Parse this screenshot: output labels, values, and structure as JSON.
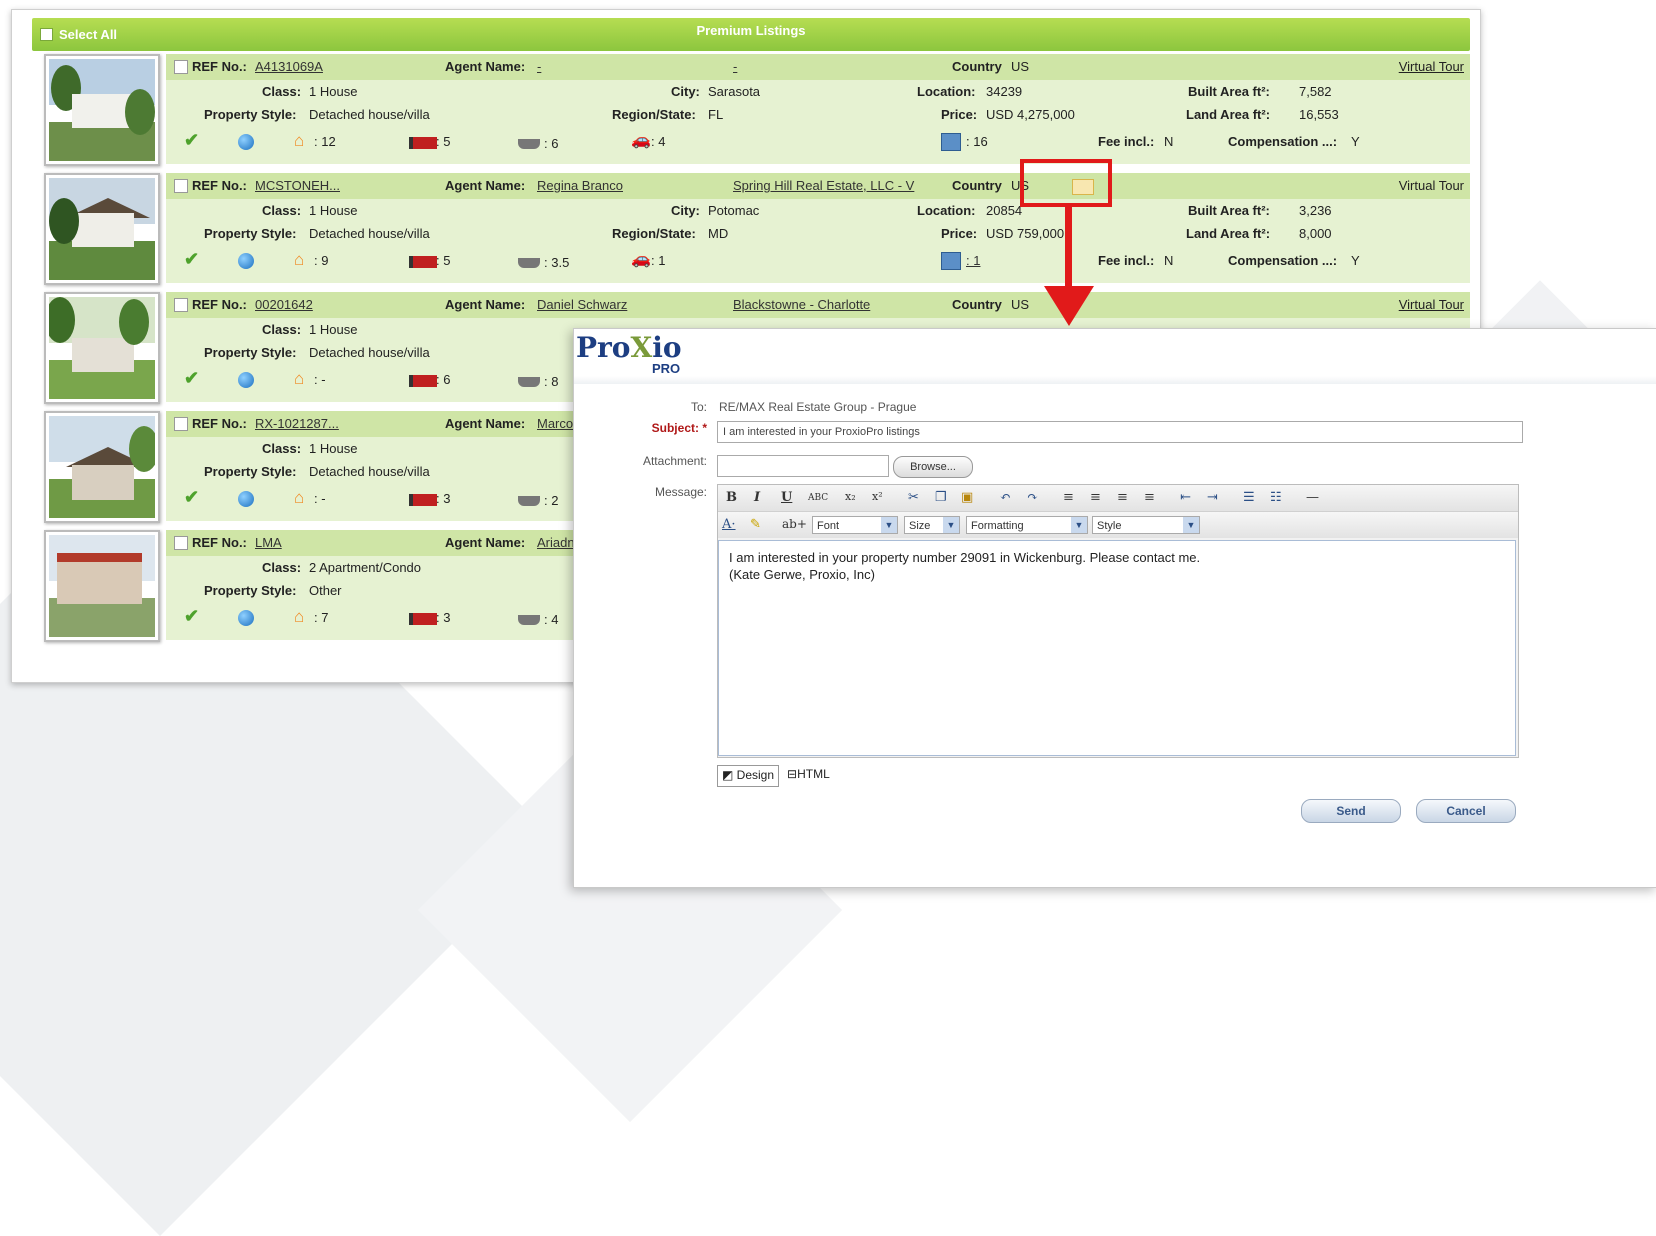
{
  "listings": {
    "select_all": "Select All",
    "title": "Premium Listings",
    "labels": {
      "ref": "REF No.:",
      "agent": "Agent Name:",
      "country": "Country",
      "class": "Class:",
      "city": "City:",
      "location": "Location:",
      "built": "Built Area ft²:",
      "style": "Property Style:",
      "region": "Region/State:",
      "price": "Price:",
      "land": "Land Area ft²:",
      "fee": "Fee incl.:",
      "comp": "Compensation ...:",
      "virtual_tour": "Virtual Tour"
    },
    "rows": [
      {
        "ref": "A4131069A",
        "agent": "-",
        "company": "-",
        "country": "US",
        "class": "1 House",
        "city": "Sarasota",
        "location": "34239",
        "built": "7,582",
        "style": "Detached house/villa",
        "region": "FL",
        "price": "USD 4,275,000",
        "land": "16,553",
        "rooms_home": ": 12",
        "beds": ": 5",
        "baths": ": 6",
        "cars": ": 4",
        "rooms": ": 16",
        "fee": "N",
        "comp": "Y"
      },
      {
        "ref": "MCSTONEH...",
        "agent": "Regina Branco",
        "company": "Spring Hill Real Estate, LLC - V",
        "country": "US",
        "class": "1 House",
        "city": "Potomac",
        "location": "20854",
        "built": "3,236",
        "style": "Detached house/villa",
        "region": "MD",
        "price": "USD 759,000",
        "land": "8,000",
        "rooms_home": ": 9",
        "beds": ": 5",
        "baths": ": 3.5",
        "cars": ": 1",
        "rooms": ": 1",
        "fee": "N",
        "comp": "Y"
      },
      {
        "ref": "00201642",
        "agent": "Daniel Schwarz",
        "company": "Blackstowne - Charlotte",
        "country": "US",
        "class": "1 House",
        "style": "Detached house/villa",
        "rooms_home": ": -",
        "beds": ": 6",
        "baths": ": 8"
      },
      {
        "ref": "RX-1021287...",
        "agent": "Marco R",
        "class": "1 House",
        "style": "Detached house/villa",
        "rooms_home": ": -",
        "beds": ": 3",
        "baths": ": 2"
      },
      {
        "ref": "LMA",
        "agent": "Ariadne",
        "class": "2 Apartment/Condo",
        "style": "Other",
        "rooms_home": ": 7",
        "beds": ": 3",
        "baths": ": 4"
      }
    ]
  },
  "dialog": {
    "logo_main_a": "Pro",
    "logo_main_x": "X",
    "logo_main_b": "io",
    "logo_sub": "PRO",
    "to_label": "To:",
    "to_value": "RE/MAX Real Estate Group - Prague",
    "subject_label": "Subject:",
    "subject_value": "I am interested in your ProxioPro listings",
    "attachment_label": "Attachment:",
    "browse": "Browse...",
    "message_label": "Message:",
    "font_select": "Font",
    "size_select": "Size",
    "formatting_select": "Formatting",
    "style_select": "Style",
    "message_line1": "I am interested in your property number 29091 in Wickenburg. Please contact me.",
    "message_line2": "(Kate Gerwe, Proxio, Inc)",
    "tab_design": "Design",
    "tab_html": "HTML",
    "send": "Send",
    "cancel": "Cancel"
  },
  "colors": {
    "header_green": "#8cc63e",
    "row_green": "#e6f2d2",
    "highlight_red": "#e11a1a",
    "brand_blue": "#1d3e82"
  }
}
